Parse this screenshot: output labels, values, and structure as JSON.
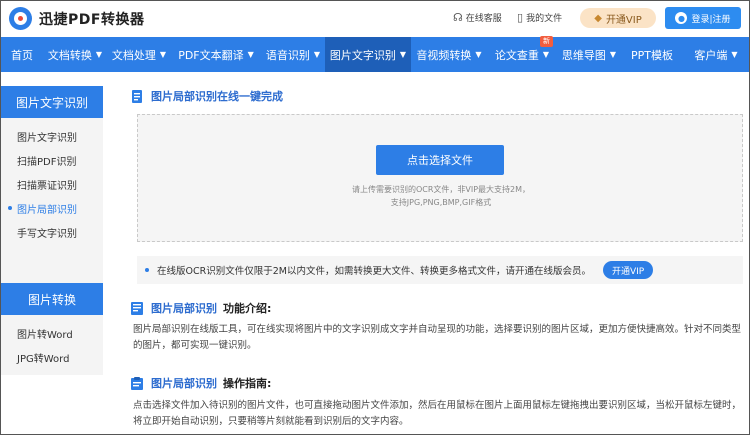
{
  "header": {
    "logo_text": "迅捷PDF转换器",
    "service_label": "在线客服",
    "myfiles_label": "我的文件",
    "vip_label": "开通VIP",
    "login_label": "登录|注册"
  },
  "nav": {
    "items": [
      {
        "label": "首页",
        "caret": ""
      },
      {
        "label": "文档转换",
        "caret": "▼"
      },
      {
        "label": "文档处理",
        "caret": "▼"
      },
      {
        "label": "PDF文本翻译",
        "caret": "▼"
      },
      {
        "label": "语音识别",
        "caret": "▼"
      },
      {
        "label": "图片文字识别",
        "caret": "▼"
      },
      {
        "label": "音视频转换",
        "caret": "▼"
      },
      {
        "label": "论文查重",
        "caret": "▼",
        "badge": "新"
      },
      {
        "label": "思维导图",
        "caret": "▼"
      },
      {
        "label": "PPT模板",
        "caret": ""
      },
      {
        "label": "客户端",
        "caret": "▼"
      }
    ]
  },
  "sidebar": {
    "group1_title": "图片文字识别",
    "group1_items": [
      "图片文字识别",
      "扫描PDF识别",
      "扫描票证识别",
      "图片局部识别",
      "手写文字识别"
    ],
    "group2_title": "图片转换",
    "group2_items": [
      "图片转Word",
      "JPG转Word"
    ]
  },
  "main": {
    "title": "图片局部识别在线一键完成",
    "upload_button": "点击选择文件",
    "upload_tip_line1": "请上传需要识别的OCR文件，非VIP最大支持2M，",
    "upload_tip_line2": "支持JPG,PNG,BMP,GIF格式",
    "notice_text": "在线版OCR识别文件仅限于2M以内文件，如需转换更大文件、转换更多格式文件，请开通在线版会员。",
    "notice_vip": "开通VIP",
    "intro_title_blue": "图片局部识别",
    "intro_title_dark": "功能介绍:",
    "intro_text": "图片局部识别在线版工具，可在线实现将图片中的文字识别成文字并自动呈现的功能，选择要识别的图片区域，更加方便快捷高效。针对不同类型的图片，都可实现一键识别。",
    "guide_title_blue": "图片局部识别",
    "guide_title_dark": "操作指南:",
    "guide_text": "点击选择文件加入待识别的图片文件，也可直接拖动图片文件添加，然后在用鼠标在图片上面用鼠标左键拖拽出要识别区域，当松开鼠标左键时，将立即开始自动识别，只要稍等片刻就能看到识别后的文字内容。"
  },
  "colors": {
    "brand_blue": "#2d7ee6",
    "nav_active": "#1e5fb8",
    "badge_red": "#f25d3e"
  }
}
